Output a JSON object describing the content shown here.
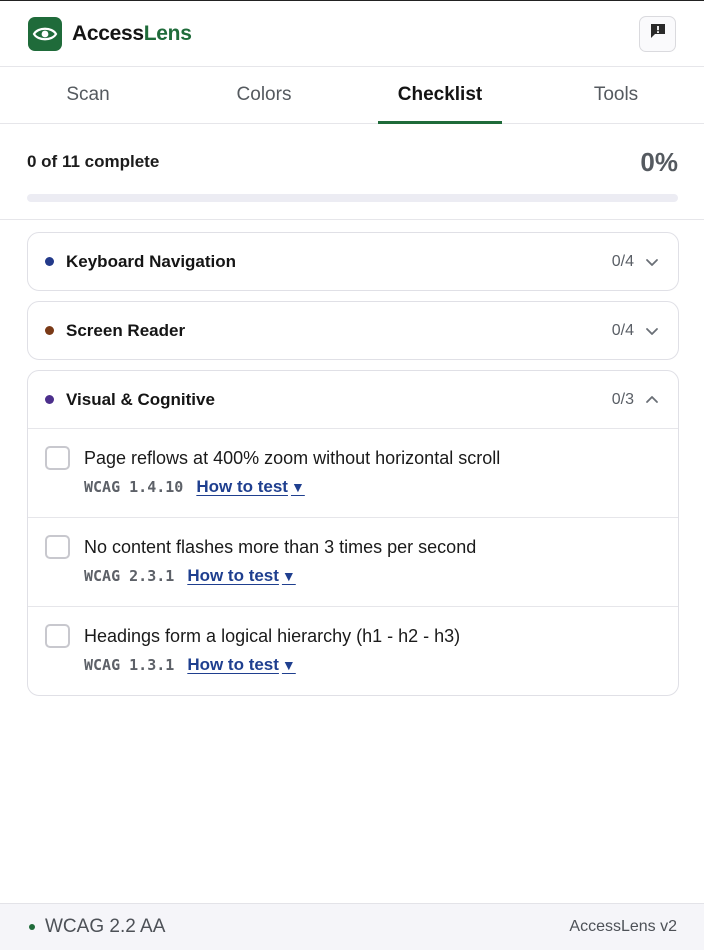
{
  "app": {
    "brand_part1": "Access",
    "brand_part2": "Lens"
  },
  "colors": {
    "brand_green": "#1f6b3a",
    "link_blue": "#1f3f8f"
  },
  "tabs": [
    {
      "label": "Scan",
      "active": false
    },
    {
      "label": "Colors",
      "active": false
    },
    {
      "label": "Checklist",
      "active": true
    },
    {
      "label": "Tools",
      "active": false
    }
  ],
  "progress": {
    "label": "0 of 11 complete",
    "percent_text": "0%",
    "fraction": 0.0
  },
  "sections": [
    {
      "title": "Keyboard Navigation",
      "count": "0/4",
      "dot_color": "#233a8a",
      "expanded": false,
      "icon": "chevron-down-icon"
    },
    {
      "title": "Screen Reader",
      "count": "0/4",
      "dot_color": "#7a3a17",
      "expanded": false,
      "icon": "chevron-down-icon"
    },
    {
      "title": "Visual & Cognitive",
      "count": "0/3",
      "dot_color": "#4c2f8c",
      "expanded": true,
      "icon": "chevron-up-icon",
      "items": [
        {
          "text": "Page reflows at 400% zoom without horizontal scroll",
          "wcag": "WCAG 1.4.10",
          "link": "How to test",
          "link_icon": "▼",
          "checked": false
        },
        {
          "text": "No content flashes more than 3 times per second",
          "wcag": "WCAG 2.3.1",
          "link": "How to test",
          "link_icon": "▼",
          "checked": false
        },
        {
          "text": "Headings form a logical hierarchy (h1 - h2 - h3)",
          "wcag": "WCAG 1.3.1",
          "link": "How to test",
          "link_icon": "▼",
          "checked": false
        }
      ]
    }
  ],
  "footer": {
    "level": "WCAG 2.2 AA",
    "version": "AccessLens v2"
  }
}
